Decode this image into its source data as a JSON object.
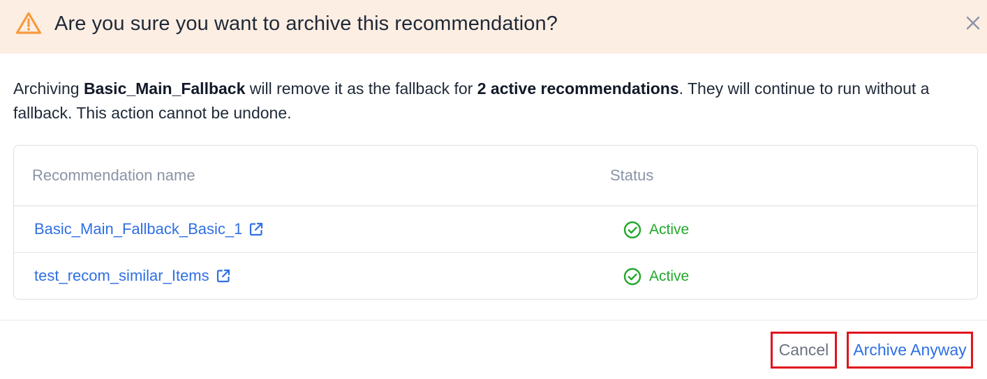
{
  "dialog": {
    "title": "Are you sure you want to archive this recommendation?",
    "icons": {
      "warning": "warning-triangle-icon",
      "close": "close-icon"
    },
    "colors": {
      "header_bg": "#fdeee3",
      "warning": "#f79a3c",
      "link": "#2f6fe4",
      "active": "#22a82a",
      "highlight_border": "#e0131c"
    }
  },
  "message": {
    "prefix": "Archiving ",
    "fallback_name": "Basic_Main_Fallback",
    "middle": " will remove it as the fallback for ",
    "count_text": "2 active recommendations",
    "suffix": ". They will continue to run without a fallback. This action cannot be undone."
  },
  "table": {
    "columns": {
      "name": "Recommendation name",
      "status": "Status"
    },
    "rows": [
      {
        "name": "Basic_Main_Fallback_Basic_1",
        "status": "Active",
        "link_icon": "external-link-icon",
        "status_icon": "check-circle-icon"
      },
      {
        "name": "test_recom_similar_Items",
        "status": "Active",
        "link_icon": "external-link-icon",
        "status_icon": "check-circle-icon"
      }
    ]
  },
  "footer": {
    "cancel_label": "Cancel",
    "archive_label": "Archive Anyway"
  }
}
